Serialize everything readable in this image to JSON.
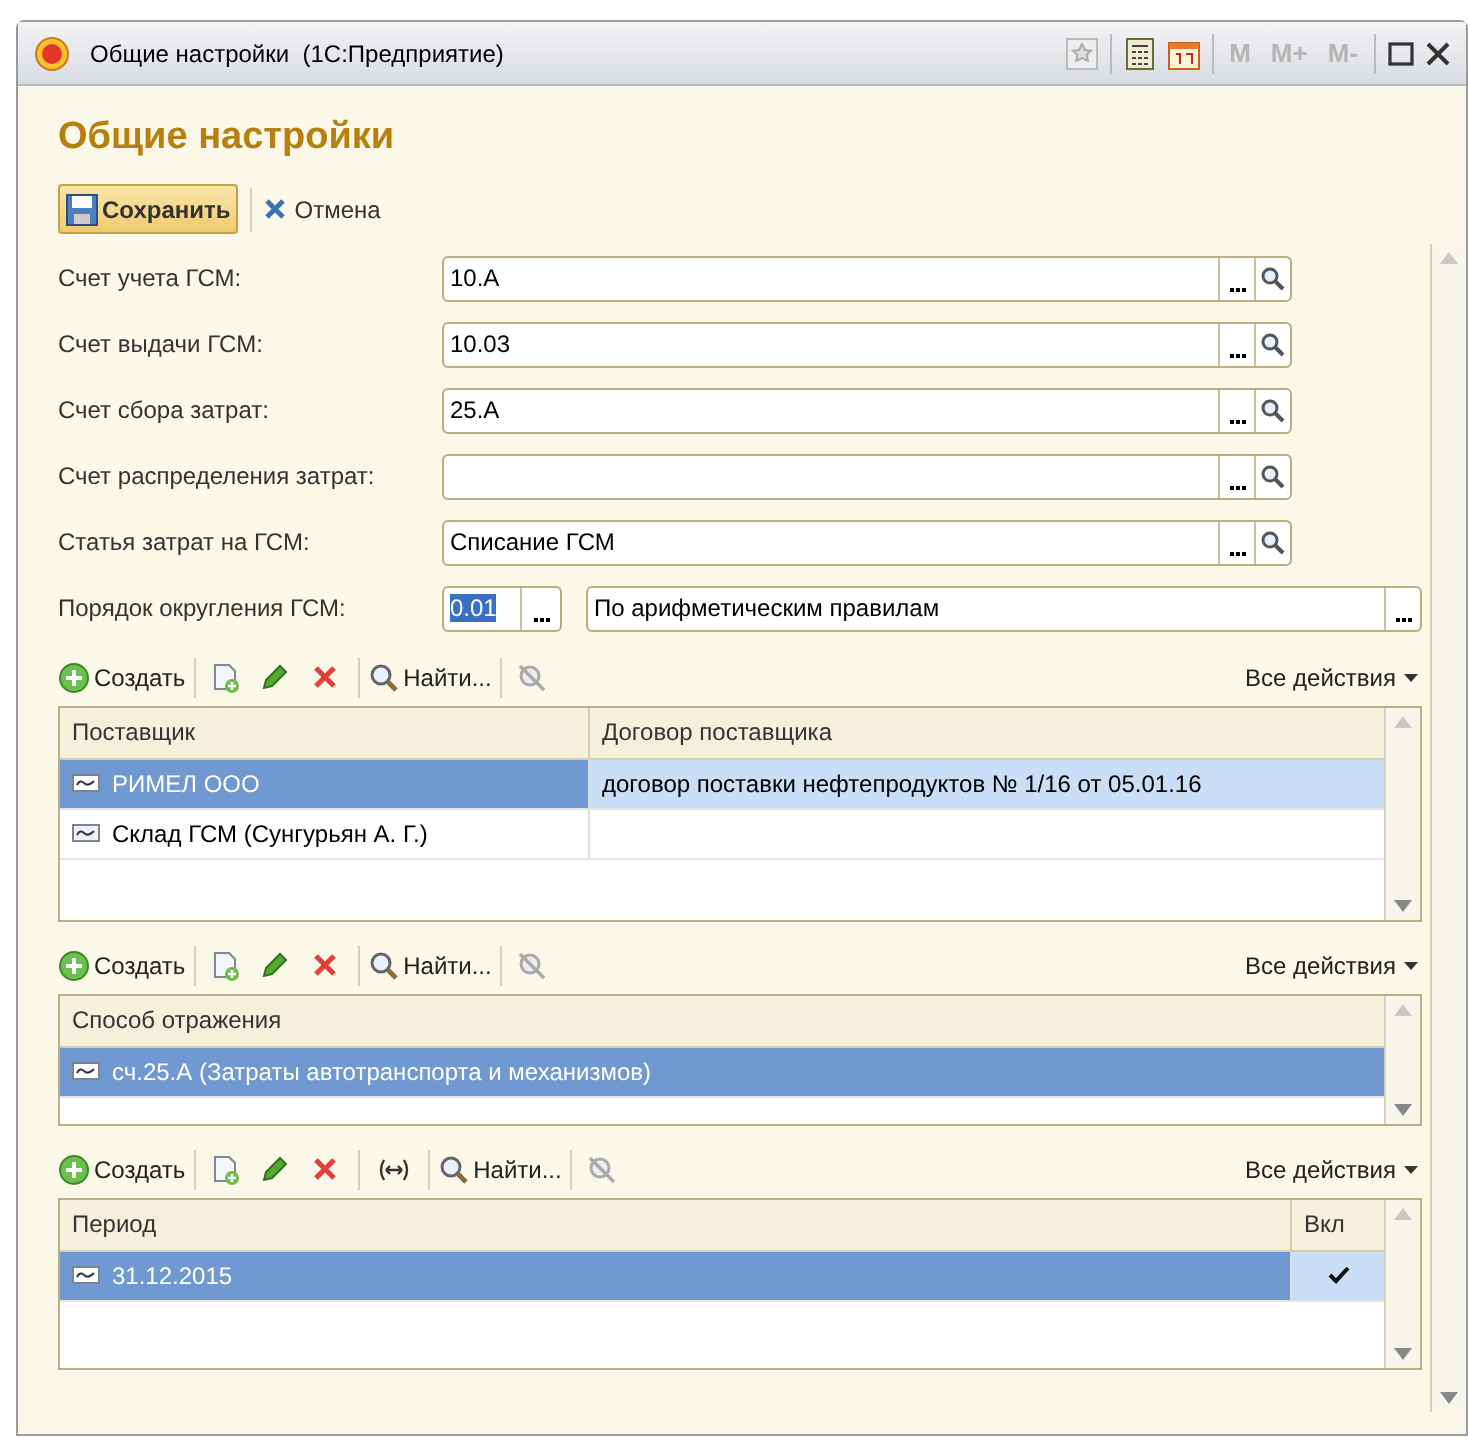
{
  "window": {
    "title": "Общие настройки  (1С:Предприятие)",
    "calc_buttons": [
      "M",
      "M+",
      "M-"
    ]
  },
  "heading": "Общие настройки",
  "command_bar": {
    "save": "Сохранить",
    "cancel": "Отмена"
  },
  "fields": [
    {
      "label": "Счет учета ГСМ:",
      "value": "10.А"
    },
    {
      "label": "Счет выдачи ГСМ:",
      "value": "10.03"
    },
    {
      "label": "Счет сбора затрат:",
      "value": "25.А"
    },
    {
      "label": "Счет распределения затрат:"
    },
    {
      "label": "Статья затрат на ГСМ:",
      "value": "Списание ГСМ"
    }
  ],
  "rounding": {
    "label": "Порядок округления ГСМ:",
    "value": "0.01",
    "method": "По арифметическим правилам"
  },
  "tables": [
    {
      "toolbar": {
        "create": "Создать",
        "find": "Найти...",
        "actions": "Все действия",
        "period_button": false
      },
      "columns": [
        "Поставщик",
        "Договор поставщика"
      ],
      "rows": [
        {
          "selected": true,
          "cells": [
            "РИМЕЛ ООО",
            "договор поставки нефтепродуктов № 1/16 от 05.01.16"
          ]
        },
        {
          "selected": false,
          "cells": [
            "Склад   ГСМ  (Сунгурьян А. Г.)"
          ]
        }
      ]
    },
    {
      "toolbar": {
        "create": "Создать",
        "find": "Найти...",
        "actions": "Все действия",
        "period_button": false
      },
      "columns": [
        "Способ отражения"
      ],
      "rows": [
        {
          "selected": true,
          "cells": [
            "сч.25.А (Затраты автотранспорта и механизмов)"
          ]
        }
      ]
    },
    {
      "toolbar": {
        "create": "Создать",
        "find": "Найти...",
        "actions": "Все действия",
        "period_button": true
      },
      "columns": [
        "Период",
        "Вкл"
      ],
      "rows": [
        {
          "selected": true,
          "enabled": true,
          "cells": [
            "31.12.2015"
          ]
        }
      ]
    }
  ]
}
